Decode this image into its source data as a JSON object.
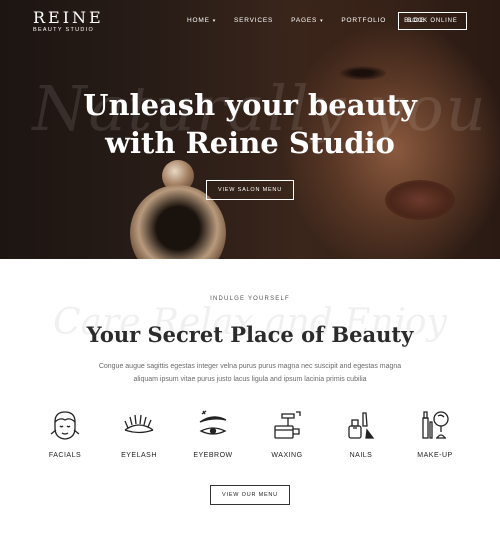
{
  "brand": {
    "name": "REINE",
    "subtitle": "BEAUTY STUDIO"
  },
  "nav": {
    "items": [
      {
        "label": "HOME",
        "dropdown": true
      },
      {
        "label": "SERVICES",
        "dropdown": false
      },
      {
        "label": "PAGES",
        "dropdown": true
      },
      {
        "label": "PORTFOLIO",
        "dropdown": false
      },
      {
        "label": "BLOG",
        "dropdown": false
      }
    ],
    "book_button": "BOOK ONLINE"
  },
  "hero": {
    "script_text": "Naturally you",
    "title_line1": "Unleash your beauty",
    "title_line2": "with Reine Studio",
    "button": "VIEW SALON MENU"
  },
  "intro": {
    "kicker": "INDULGE YOURSELF",
    "script_text": "Care Relax and Enjoy",
    "title": "Your Secret Place of Beauty",
    "description": "Congue augue sagittis egestas integer velna purus purus magna nec suscipit and egestas magna aliquam ipsum vitae purus justo lacus ligula and ipsum lacinia primis cubilia"
  },
  "services": [
    {
      "label": "FACIALS",
      "icon": "facial-icon"
    },
    {
      "label": "EYELASH",
      "icon": "eyelash-icon"
    },
    {
      "label": "EYEBROW",
      "icon": "eyebrow-icon"
    },
    {
      "label": "WAXING",
      "icon": "waxing-icon"
    },
    {
      "label": "NAILS",
      "icon": "nail-polish-icon"
    },
    {
      "label": "MAKE-UP",
      "icon": "makeup-icon"
    }
  ],
  "menu_button": "VIEW OUR MENU",
  "colors": {
    "hero_dark": "#2a1d17",
    "text_dark": "#2b2b2b",
    "text_muted": "#6a6a6a"
  }
}
